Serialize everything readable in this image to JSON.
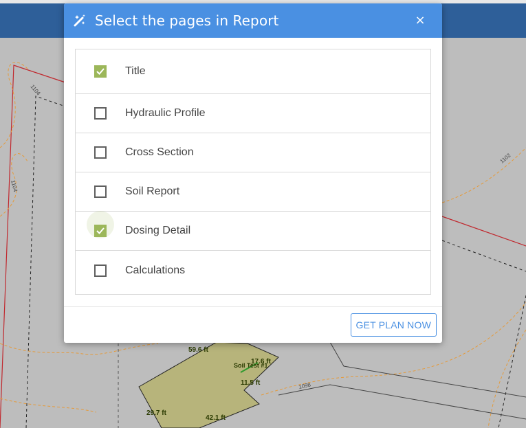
{
  "modal": {
    "title": "Select the pages in Report",
    "close_label": "×",
    "header_icon": "magic-wand-icon",
    "action_label": "GET PLAN NOW"
  },
  "pages": [
    {
      "label": "Title",
      "checked": true
    },
    {
      "label": "Hydraulic Profile",
      "checked": false
    },
    {
      "label": "Cross Section",
      "checked": false
    },
    {
      "label": "Soil Report",
      "checked": false
    },
    {
      "label": "Dosing Detail",
      "checked": true
    },
    {
      "label": "Calculations",
      "checked": false
    }
  ],
  "map": {
    "measurements": [
      "59.6 ft",
      "17.6 ft",
      "Soil Test #1",
      "11.5 ft",
      "29.7 ft",
      "42.1 ft"
    ],
    "contours": [
      "1104",
      "1104",
      "1102",
      "1098"
    ]
  },
  "colors": {
    "header": "#4a90e2",
    "checkbox_checked": "#9cb75a",
    "app_bar": "#2e5f99",
    "map_bg": "#bdbdbd",
    "contour": "#e59a3a",
    "boundary": "#c0282e"
  }
}
